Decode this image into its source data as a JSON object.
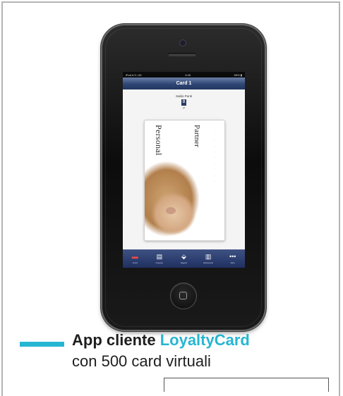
{
  "screen": {
    "status": {
      "left": "iPod ▾ 3 • 00",
      "time": "9:45",
      "right": "55% ▮"
    },
    "nav_title": "Card 1",
    "saldo_label": "Saldo Punti",
    "saldo_value": "0",
    "saldo_unit": "pt",
    "card": {
      "brand_left": "Personal",
      "brand_right": "Partner",
      "dots": "· · · · · · · · · ·"
    },
    "tabs": [
      {
        "icon": "card-icon",
        "label": "Card"
      },
      {
        "icon": "coupon-icon",
        "label": "Coupon"
      },
      {
        "icon": "map-pin-icon",
        "label": "Negozi"
      },
      {
        "icon": "chart-icon",
        "label": "Movimenti"
      },
      {
        "icon": "more-icon",
        "label": "Altro"
      }
    ]
  },
  "caption": {
    "line1_prefix": "App cliente",
    "line1_brand": "LoyaltyCard",
    "line2": "con 500 card virtuali"
  },
  "colors": {
    "accent": "#27b6d2",
    "nav": "#2f4676",
    "frame": "#b5b5b5"
  }
}
